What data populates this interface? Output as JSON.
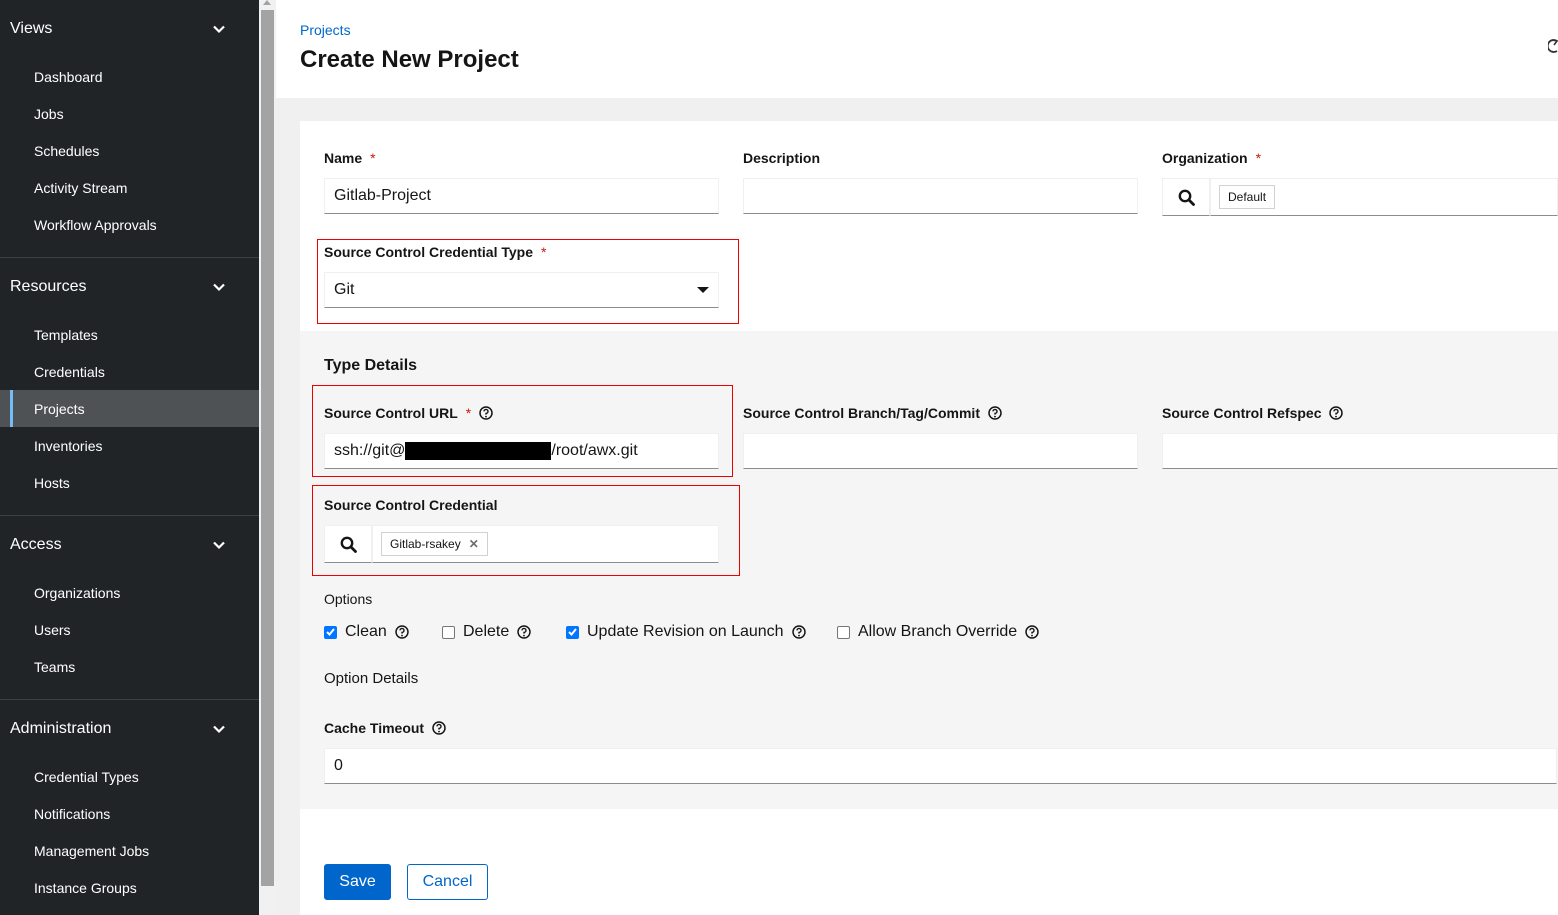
{
  "sidebar": {
    "groups": [
      {
        "title": "Views",
        "items": [
          "Dashboard",
          "Jobs",
          "Schedules",
          "Activity Stream",
          "Workflow Approvals"
        ]
      },
      {
        "title": "Resources",
        "items": [
          "Templates",
          "Credentials",
          "Projects",
          "Inventories",
          "Hosts"
        ]
      },
      {
        "title": "Access",
        "items": [
          "Organizations",
          "Users",
          "Teams"
        ]
      },
      {
        "title": "Administration",
        "items": [
          "Credential Types",
          "Notifications",
          "Management Jobs",
          "Instance Groups"
        ]
      }
    ],
    "active_item": "Projects"
  },
  "header": {
    "breadcrumb": "Projects",
    "title": "Create New Project"
  },
  "form": {
    "name": {
      "label": "Name",
      "required": "*",
      "value": "Gitlab-Project"
    },
    "description": {
      "label": "Description",
      "value": ""
    },
    "organization": {
      "label": "Organization",
      "required": "*",
      "chip": "Default"
    },
    "scm_type": {
      "label": "Source Control Credential Type",
      "required": "*",
      "value": "Git"
    },
    "type_details": {
      "title": "Type Details"
    },
    "scm_url": {
      "label": "Source Control URL",
      "required": "*",
      "value_prefix": "ssh://git@",
      "value_suffix": "/root/awx.git"
    },
    "scm_branch": {
      "label": "Source Control Branch/Tag/Commit",
      "value": ""
    },
    "scm_refspec": {
      "label": "Source Control Refspec",
      "value": ""
    },
    "credential": {
      "label": "Source Control Credential",
      "chip": "Gitlab-rsakey"
    },
    "options": {
      "title": "Options",
      "items": [
        {
          "label": "Clean",
          "checked": true
        },
        {
          "label": "Delete",
          "checked": false
        },
        {
          "label": "Update Revision on Launch",
          "checked": true
        },
        {
          "label": "Allow Branch Override",
          "checked": false
        }
      ]
    },
    "option_details": {
      "title": "Option Details"
    },
    "cache_timeout": {
      "label": "Cache Timeout",
      "value": "0"
    }
  },
  "actions": {
    "save": "Save",
    "cancel": "Cancel"
  },
  "colors": {
    "sidebar_bg": "#212427",
    "active_item_bg": "#4f5255",
    "accent": "#0066cc",
    "required": "#c9190b",
    "highlight_box": "#e00000"
  }
}
